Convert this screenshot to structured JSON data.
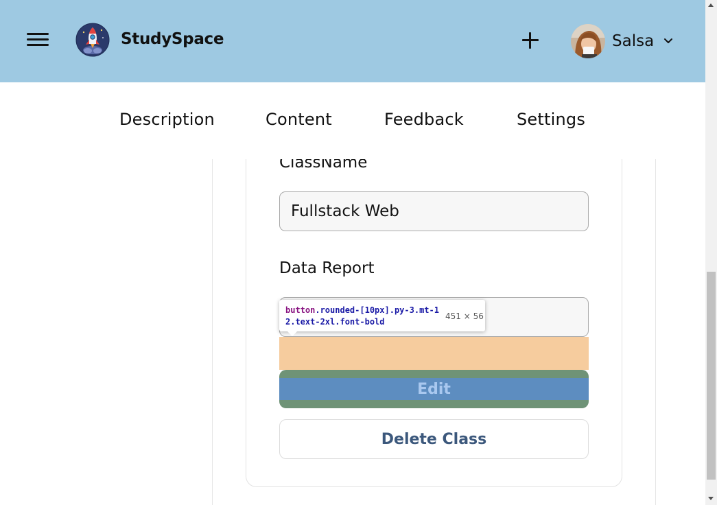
{
  "header": {
    "brand": "StudySpace",
    "username": "Salsa",
    "colors": {
      "background": "#9ec9e2"
    },
    "icons": {
      "menu": "hamburger-icon",
      "logo": "rocket-logo",
      "add": "plus-icon",
      "user_menu": "chevron-down-icon"
    }
  },
  "tabs": [
    {
      "label": "Description"
    },
    {
      "label": "Content"
    },
    {
      "label": "Feedback"
    },
    {
      "label": "Settings"
    }
  ],
  "form": {
    "class_name": {
      "label": "ClassName",
      "value": "Fullstack Web"
    },
    "data_report": {
      "label": "Data Report",
      "value": ""
    },
    "edit_label": "Edit",
    "delete_label": "Delete Class"
  },
  "devtools_tooltip": {
    "tag": "button",
    "classes": ".rounded-[10px].py-3.mt-12.text-2xl.font-bold",
    "size": "451 × 56",
    "colors": {
      "margin": "#f6cc9e",
      "padding": "#6f9377",
      "content": "#5d8dc0"
    }
  }
}
